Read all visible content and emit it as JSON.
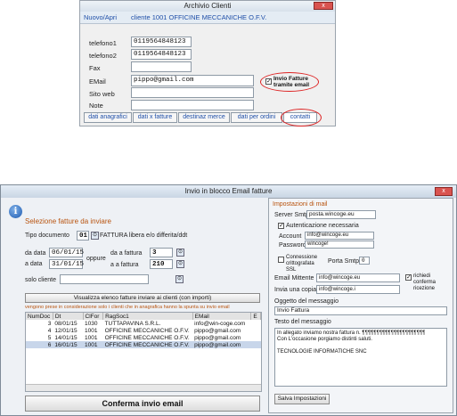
{
  "window1": {
    "title": "Archivio Clienti",
    "close_label": "x",
    "nav_new": "Nuovo/Apri",
    "client_label": "cliente 1001 OFFICINE MECCANICHE O.F.V.",
    "fields": [
      {
        "label": "telefono1",
        "value": "0119564848123"
      },
      {
        "label": "telefono2",
        "value": "0119564848123"
      },
      {
        "label": "Fax",
        "value": ""
      },
      {
        "label": "EMail",
        "value": "pippo@gmail.com"
      },
      {
        "label": "Sito web",
        "value": ""
      },
      {
        "label": "Note",
        "value": ""
      }
    ],
    "invio_checkbox_label": "Invio Fatture tramite email",
    "invio_checked": true,
    "tabs": [
      "dati anagrafici",
      "dati x fatture",
      "destinaz merce",
      "dati per ordini",
      "contatti"
    ]
  },
  "window2": {
    "title": "Invio in blocco Email fatture",
    "close_label": "x",
    "section_title": "Selezione fatture da inviare",
    "tipo_documento_label": "Tipo documento",
    "tipo_documento_code": "01",
    "tipo_documento_desc": "FATTURA libera e/o differita/ddt",
    "da_data_label": "da data",
    "da_data": "06/01/15",
    "a_data_label": "a data",
    "a_data": "31/01/15",
    "oppure_label": "oppure",
    "da_fattura_label": "da a fattura",
    "da_fattura": "3",
    "a_fattura_label": "a a fattura",
    "a_fattura": "210",
    "solo_cliente_label": "solo cliente",
    "visualizza_button": "Visualizza elenco fatture inviare ai clienti (con importi)",
    "note_text": "vengono prese in considerazione solo i clienti che in anagrafica hanno la spunta su invio email",
    "columns": [
      "NumDoc",
      "Dt",
      "ClFor",
      "RagSoc1",
      "EMail",
      "E"
    ],
    "rows": [
      {
        "num": "3",
        "dt": "08/01/15",
        "clfor": "1030",
        "ragsoc": "TUTTAPAVINA S.R.L.",
        "email": "info@win-coge.com"
      },
      {
        "num": "4",
        "dt": "12/01/15",
        "clfor": "1001",
        "ragsoc": "OFFICINE MECCANICHE O.F.V.",
        "email": "pippo@gmail.com"
      },
      {
        "num": "5",
        "dt": "14/01/15",
        "clfor": "1001",
        "ragsoc": "OFFICINE MECCANICHE O.F.V.",
        "email": "pippo@gmail.com"
      },
      {
        "num": "6",
        "dt": "16/01/15",
        "clfor": "1001",
        "ragsoc": "OFFICINE MECCANICHE O.F.V.",
        "email": "pippo@gmail.com"
      }
    ],
    "conferma_button": "Conferma invio email",
    "settings": {
      "title": "Impostazioni di mail",
      "server_label": "Server Smtp",
      "server_value": "posta.wincoge.eu",
      "auth_label": "Autenticazione necessaria",
      "auth_checked": true,
      "account_label": "Account",
      "account_value": "info@wincoge.eu",
      "password_label": "Password",
      "password_value": "wincoge!",
      "ssl_label": "Connessione crittografata SSL",
      "porta_label": "Porta Smtp",
      "porta_value": "0",
      "mittente_label": "Email Mittente",
      "mittente_value": "info@wincoge.eu",
      "copia_label": "Invia una copia a",
      "copia_value": "info@wincoge.i",
      "conferma_label": "richiedi conferma ricezione",
      "conferma_checked": true,
      "oggetto_label": "Oggetto del messaggio",
      "oggetto_value": "Invio Fattura",
      "testo_label": "Testo del messaggio",
      "testo_line1": "In allegato inviamo nostra fattura n. ¶¶¶¶¶¶¶¶¶¶¶¶¶¶¶¶¶¶¶¶¶¶",
      "testo_line2": "Con L'occasione porgiamo distinti saluti.",
      "testo_line3": "TECNOLOGIE INFORMATICHE SNC",
      "salva_button": "Salva Impostazioni"
    }
  }
}
